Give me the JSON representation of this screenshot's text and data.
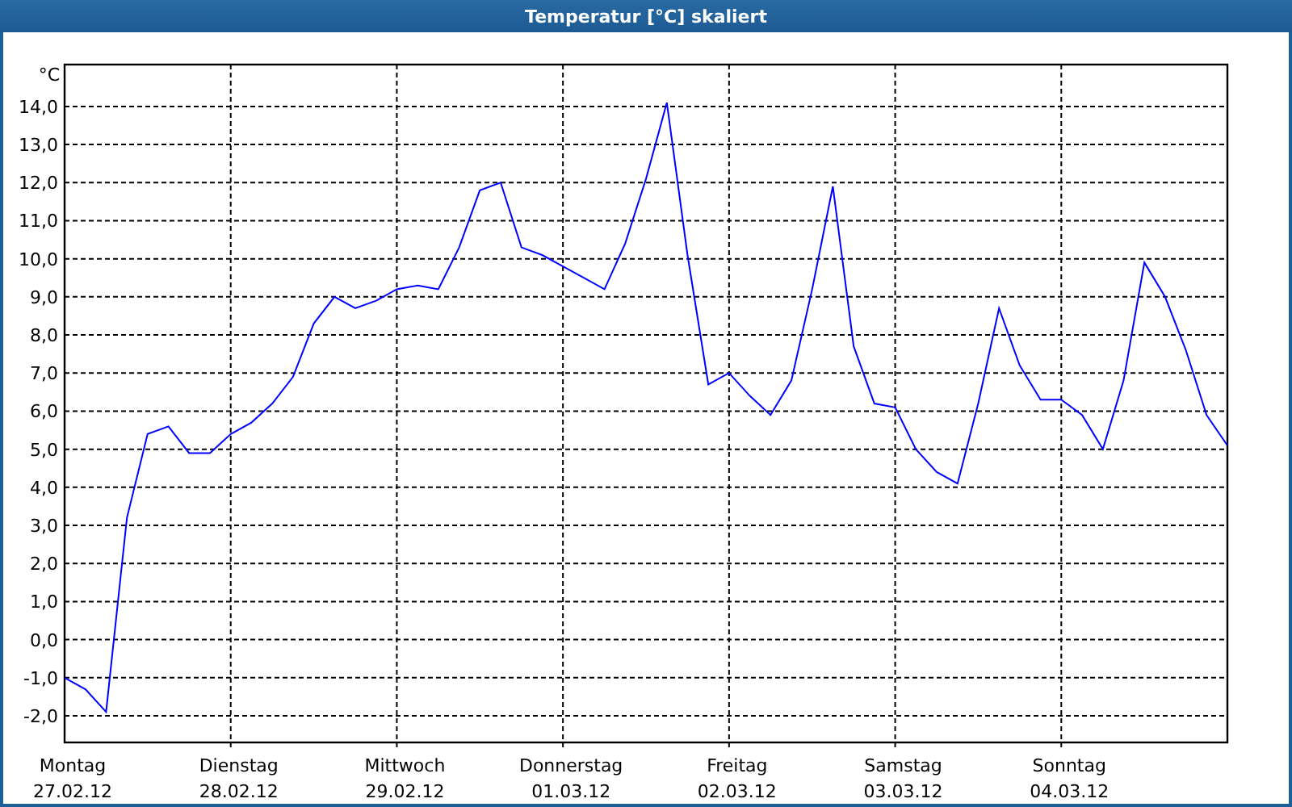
{
  "window": {
    "title": "Temperatur [°C] skaliert"
  },
  "chart": {
    "x_dates": [
      "27.02.12",
      "28.02.12",
      "29.02.12",
      "01.03.12",
      "02.03.12",
      "03.03.12",
      "04.03.12"
    ],
    "chart_data": {
      "type": "line",
      "grid": true,
      "ylabel": "°C",
      "ylim": [
        -2.7,
        15.1
      ],
      "yticks": [
        {
          "value": -2,
          "label": "-2,0"
        },
        {
          "value": -1,
          "label": "-1,0"
        },
        {
          "value": 0,
          "label": "0,0"
        },
        {
          "value": 1,
          "label": "1,0"
        },
        {
          "value": 2,
          "label": "2,0"
        },
        {
          "value": 3,
          "label": "3,0"
        },
        {
          "value": 4,
          "label": "4,0"
        },
        {
          "value": 5,
          "label": "5,0"
        },
        {
          "value": 6,
          "label": "6,0"
        },
        {
          "value": 7,
          "label": "7,0"
        },
        {
          "value": 8,
          "label": "8,0"
        },
        {
          "value": 9,
          "label": "9,0"
        },
        {
          "value": 10,
          "label": "10,0"
        },
        {
          "value": 11,
          "label": "11,0"
        },
        {
          "value": 12,
          "label": "12,0"
        },
        {
          "value": 13,
          "label": "13,0"
        },
        {
          "value": 14,
          "label": "14,0"
        }
      ],
      "categories": [
        "Montag",
        null,
        null,
        null,
        null,
        null,
        null,
        null,
        "Dienstag",
        null,
        null,
        null,
        null,
        null,
        null,
        null,
        "Mittwoch",
        null,
        null,
        null,
        null,
        null,
        null,
        null,
        "Donnerstag",
        null,
        null,
        null,
        null,
        null,
        null,
        null,
        "Freitag",
        null,
        null,
        null,
        null,
        null,
        null,
        null,
        "Samstag",
        null,
        null,
        null,
        null,
        null,
        null,
        null,
        "Sonntag",
        null,
        null,
        null,
        null,
        null,
        null,
        null,
        null
      ],
      "series": [
        {
          "color": "#0000ff",
          "values": [
            -1.0,
            -1.3,
            -1.9,
            3.2,
            5.4,
            5.6,
            4.9,
            4.9,
            5.4,
            5.7,
            6.2,
            6.9,
            8.3,
            9.0,
            8.7,
            8.9,
            9.2,
            9.3,
            9.2,
            10.3,
            11.8,
            12.0,
            10.3,
            10.1,
            9.8,
            9.5,
            9.2,
            10.4,
            12.1,
            14.1,
            10.1,
            6.7,
            7.0,
            6.4,
            5.9,
            6.8,
            9.2,
            11.9,
            7.7,
            6.2,
            6.1,
            5.0,
            4.4,
            4.1,
            6.2,
            8.7,
            7.2,
            6.3,
            6.3,
            5.9,
            5.0,
            6.8,
            9.9,
            9.0,
            7.6,
            5.9,
            5.1
          ]
        }
      ]
    }
  }
}
